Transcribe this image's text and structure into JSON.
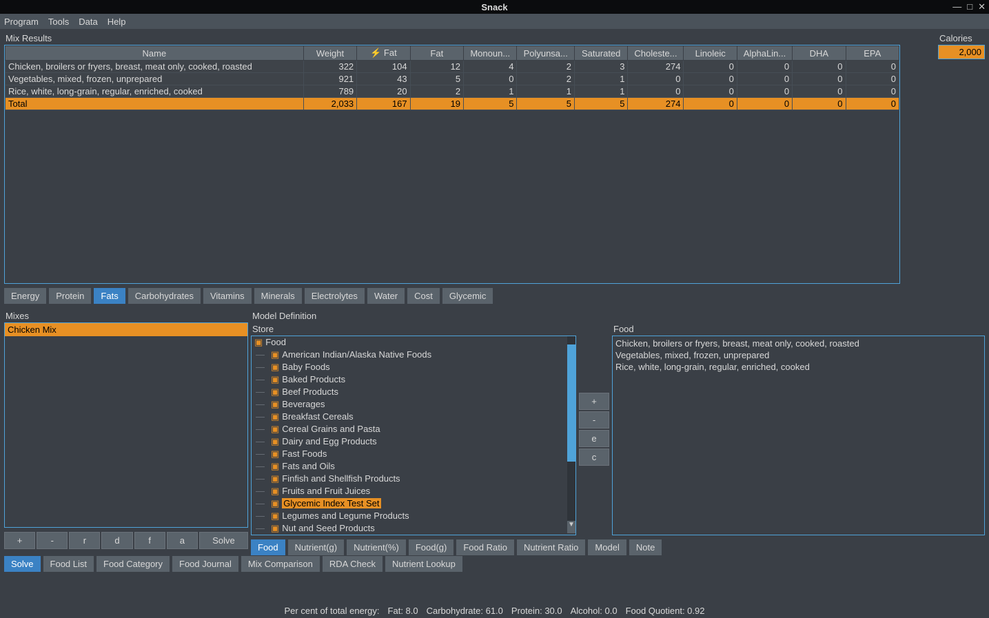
{
  "window": {
    "title": "Snack"
  },
  "menu": {
    "program": "Program",
    "tools": "Tools",
    "data": "Data",
    "help": "Help"
  },
  "mix_results": {
    "title": "Mix Results",
    "headers": [
      "Name",
      "Weight",
      "⚡ Fat",
      "Fat",
      "Monoun...",
      "Polyunsa...",
      "Saturated",
      "Choleste...",
      "Linoleic",
      "AlphaLin...",
      "DHA",
      "EPA"
    ],
    "rows": [
      {
        "name": "Chicken, broilers or fryers, breast, meat only, cooked, roasted",
        "vals": [
          "322",
          "104",
          "12",
          "4",
          "2",
          "3",
          "274",
          "0",
          "0",
          "0",
          "0"
        ]
      },
      {
        "name": "Vegetables, mixed, frozen, unprepared",
        "vals": [
          "921",
          "43",
          "5",
          "0",
          "2",
          "1",
          "0",
          "0",
          "0",
          "0",
          "0"
        ]
      },
      {
        "name": "Rice, white, long-grain, regular, enriched, cooked",
        "vals": [
          "789",
          "20",
          "2",
          "1",
          "1",
          "1",
          "0",
          "0",
          "0",
          "0",
          "0"
        ]
      }
    ],
    "total": {
      "name": "Total",
      "vals": [
        "2,033",
        "167",
        "19",
        "5",
        "5",
        "5",
        "274",
        "0",
        "0",
        "0",
        "0"
      ]
    }
  },
  "calories": {
    "label": "Calories",
    "value": "2,000"
  },
  "nutrient_tabs": [
    "Energy",
    "Protein",
    "Fats",
    "Carbohydrates",
    "Vitamins",
    "Minerals",
    "Electrolytes",
    "Water",
    "Cost",
    "Glycemic"
  ],
  "nutrient_tabs_active": 2,
  "mixes": {
    "title": "Mixes",
    "items": [
      "Chicken Mix"
    ],
    "buttons": [
      "+",
      "-",
      "r",
      "d",
      "f",
      "a",
      "Solve"
    ]
  },
  "model": {
    "title": "Model Definition",
    "store_label": "Store",
    "store_root": "Food",
    "store_items": [
      "American Indian/Alaska Native Foods",
      "Baby Foods",
      "Baked Products",
      "Beef Products",
      "Beverages",
      "Breakfast Cereals",
      "Cereal Grains and Pasta",
      "Dairy and Egg Products",
      "Fast Foods",
      "Fats and Oils",
      "Finfish and Shellfish Products",
      "Fruits and Fruit Juices",
      "Glycemic Index Test Set",
      "Legumes and Legume Products",
      "Nut and Seed Products"
    ],
    "store_selected_index": 12,
    "mid_buttons": [
      "+",
      "-",
      "e",
      "c"
    ],
    "food_label": "Food",
    "food_items": [
      "Chicken, broilers or fryers, breast, meat only, cooked, roasted",
      "Vegetables, mixed, frozen, unprepared",
      "Rice, white, long-grain, regular, enriched, cooked"
    ],
    "tabs": [
      "Food",
      "Nutrient(g)",
      "Nutrient(%)",
      "Food(g)",
      "Food Ratio",
      "Nutrient Ratio",
      "Model",
      "Note"
    ],
    "tabs_active": 0
  },
  "bottom_tabs": [
    "Solve",
    "Food List",
    "Food Category",
    "Food Journal",
    "Mix Comparison",
    "RDA Check",
    "Nutrient Lookup"
  ],
  "bottom_tabs_active": 0,
  "status": {
    "label": "Per cent of total energy:",
    "fat": "Fat: 8.0",
    "carb": "Carbohydrate: 61.0",
    "prot": "Protein: 30.0",
    "alc": "Alcohol: 0.0",
    "fq": "Food Quotient: 0.92"
  }
}
